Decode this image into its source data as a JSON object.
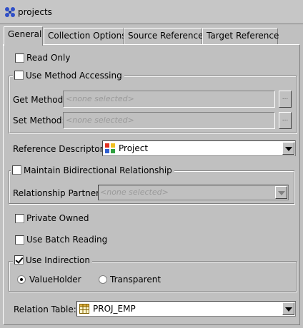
{
  "window": {
    "title": "projects"
  },
  "tabs": [
    {
      "label": "General",
      "active": true
    },
    {
      "label": "Collection Options",
      "active": false
    },
    {
      "label": "Source Reference",
      "active": false
    },
    {
      "label": "Target Reference",
      "active": false
    }
  ],
  "read_only": {
    "label": "Read Only",
    "checked": false
  },
  "method_accessing": {
    "label": "Use Method Accessing",
    "checked": false,
    "get_label": "Get Method:",
    "get_value": "<none selected>",
    "set_label": "Set Method:",
    "set_value": "<none selected>",
    "browse_label": "..."
  },
  "reference_descriptor": {
    "label": "Reference Descriptor:",
    "value": "Project"
  },
  "bidirectional": {
    "label": "Maintain Bidirectional Relationship",
    "checked": false,
    "partner_label": "Relationship Partner:",
    "partner_value": "<none selected>"
  },
  "private_owned": {
    "label": "Private Owned",
    "checked": false
  },
  "batch_reading": {
    "label": "Use Batch Reading",
    "checked": false
  },
  "indirection": {
    "label": "Use Indirection",
    "checked": true,
    "options": [
      {
        "label": "ValueHolder",
        "selected": true
      },
      {
        "label": "Transparent",
        "selected": false
      }
    ]
  },
  "relation_table": {
    "label": "Relation Table:",
    "value": "PROJ_EMP"
  }
}
